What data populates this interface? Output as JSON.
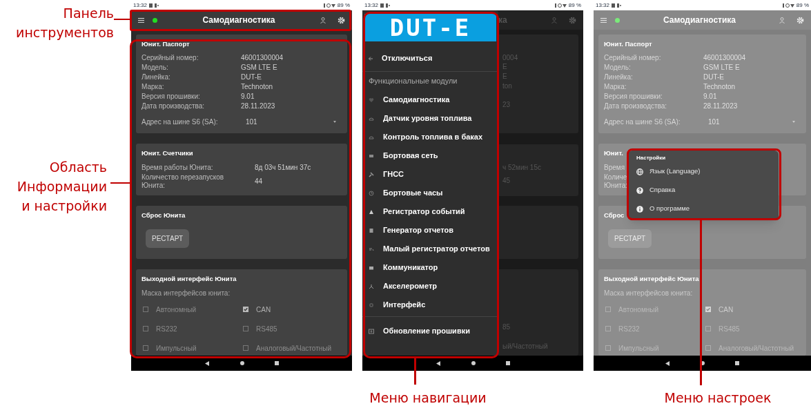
{
  "annotations": [
    {
      "text": "Панель\nинструментов"
    },
    {
      "text": "Область\nИнформации\nи настройки"
    },
    {
      "text": "Меню навигации"
    },
    {
      "text": "Меню настроек"
    }
  ],
  "screen_main": {
    "status_bar": {
      "time": "13:32",
      "battery": "89 %"
    },
    "toolbar": {
      "title": "Самодиагностика"
    },
    "cards": [
      {
        "kind": "info",
        "title": "Юнит. Паспорт",
        "rows": [
          {
            "label": "Серийный номер:",
            "value": "46001300004"
          },
          {
            "label": "Модель:",
            "value": "GSM LTE E"
          },
          {
            "label": "Линейка:",
            "value": "DUT-E"
          },
          {
            "label": "Марка:",
            "value": "Technoton"
          },
          {
            "label": "Версия прошивки:",
            "value": "9.01"
          },
          {
            "label": "Дата производства:",
            "value": "28.11.2023"
          }
        ],
        "select": {
          "label": "Адрес на шине S6 (SA):",
          "value": "101"
        }
      },
      {
        "kind": "info",
        "title": "Юнит. Счетчики",
        "rows": [
          {
            "label": "Время работы Юнита:",
            "value": "8д 03ч 51мин 37с"
          },
          {
            "label": "Количество перезапусков Юнита:",
            "value": "44"
          }
        ]
      },
      {
        "kind": "action",
        "title": "Сброс Юнита",
        "button": "РЕСТАРТ"
      },
      {
        "kind": "checks",
        "title": "Выходной интерфейс Юнита",
        "subtitle": "Маска интерфейсов юнита:",
        "options": [
          {
            "label": "Автономный",
            "checked": false
          },
          {
            "label": "CAN",
            "checked": true
          },
          {
            "label": "RS232",
            "checked": false
          },
          {
            "label": "RS485",
            "checked": false
          },
          {
            "label": "Импульсный",
            "checked": false
          },
          {
            "label": "Аналоговый/Частотный",
            "checked": false
          }
        ]
      }
    ]
  },
  "screen_drawer": {
    "status_bar": {
      "time": "13:32",
      "battery": "89 %"
    },
    "drawer": {
      "logo": "DUT-E",
      "disconnect": "Отключиться",
      "section": "Функциональные модули",
      "items": [
        {
          "label": "Самодиагностика"
        },
        {
          "label": "Датчик уровня топлива"
        },
        {
          "label": "Контроль топлива в баках"
        },
        {
          "label": "Бортовая сеть"
        },
        {
          "label": "ГНСС"
        },
        {
          "label": "Бортовые часы"
        },
        {
          "label": "Регистратор событий"
        },
        {
          "label": "Генератор отчетов"
        },
        {
          "label": "Малый регистратор отчетов"
        },
        {
          "label": "Коммуникатор"
        },
        {
          "label": "Акселерометр"
        },
        {
          "label": "Интерфейс"
        }
      ],
      "footer": "Обновление прошивки"
    },
    "behind": {
      "title": "ка",
      "texts": [
        "0004",
        "E",
        "E",
        "ton",
        "23",
        "ч 52мин 15с",
        "45",
        "85",
        "ый/Частотный"
      ]
    }
  },
  "screen_settings": {
    "status_bar": {
      "time": "13:32",
      "battery": "89 %"
    },
    "toolbar": {
      "title": "Самодиагностика"
    },
    "cards": [
      {
        "kind": "info",
        "title": "Юнит. Паспорт",
        "rows": [
          {
            "label": "Серийный номер:",
            "value": "46001300004"
          },
          {
            "label": "Модель:",
            "value": "GSM LTE E"
          },
          {
            "label": "Линейка:",
            "value": "DUT-E"
          },
          {
            "label": "Марка:",
            "value": "Technoton"
          },
          {
            "label": "Версия прошивки:",
            "value": "9.01"
          },
          {
            "label": "Дата производства:",
            "value": "28.11.2023"
          }
        ],
        "select": {
          "label": "Адрес на шине S6 (SA):",
          "value": "101"
        }
      },
      {
        "kind": "info",
        "title": "Юнит.",
        "rows": [
          {
            "label": "Время"
          },
          {
            "label": "Количе\nЮнита:"
          }
        ]
      },
      {
        "kind": "action",
        "title": "Сброс",
        "button": "РЕСТАРТ"
      },
      {
        "kind": "checks",
        "title": "Выходной интерфейс Юнита",
        "subtitle": "Маска интерфейсов юнита:",
        "options": [
          {
            "label": "Автономный",
            "checked": false
          },
          {
            "label": "CAN",
            "checked": true
          },
          {
            "label": "RS232",
            "checked": false
          },
          {
            "label": "RS485",
            "checked": false
          },
          {
            "label": "Импульсный",
            "checked": false
          },
          {
            "label": "Аналоговый/Частотный",
            "checked": false
          }
        ]
      }
    ],
    "popup": {
      "title": "Настройки",
      "items": [
        {
          "label": "Язык (Language)"
        },
        {
          "label": "Справка"
        },
        {
          "label": "О программе"
        }
      ]
    }
  }
}
